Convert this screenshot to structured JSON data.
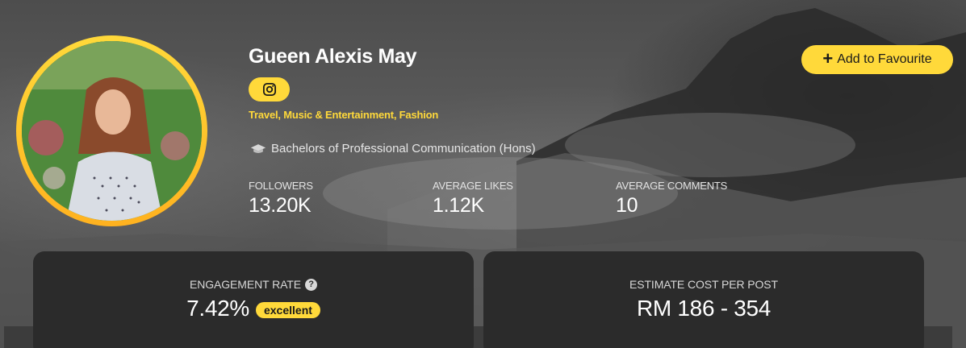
{
  "profile": {
    "name": "Gueen Alexis May",
    "platform_icon": "instagram-icon",
    "categories": "Travel, Music & Entertainment, Fashion",
    "education_icon": "graduation-cap-icon",
    "education": "Bachelors of Professional Communication (Hons)"
  },
  "stats": [
    {
      "label": "FOLLOWERS",
      "value": "13.20K"
    },
    {
      "label": "AVERAGE LIKES",
      "value": "1.12K"
    },
    {
      "label": "AVERAGE COMMENTS",
      "value": "10"
    }
  ],
  "actions": {
    "favourite_icon": "plus-icon",
    "favourite_label": "Add to Favourite"
  },
  "cards": {
    "engagement": {
      "label": "ENGAGEMENT RATE",
      "help_icon": "question-circle-icon",
      "value": "7.42%",
      "rating": "excellent"
    },
    "cost": {
      "label": "ESTIMATE COST PER POST",
      "value": "RM 186 - 354"
    }
  },
  "colors": {
    "accent": "#ffd93a",
    "card_bg": "#2b2b2b"
  }
}
